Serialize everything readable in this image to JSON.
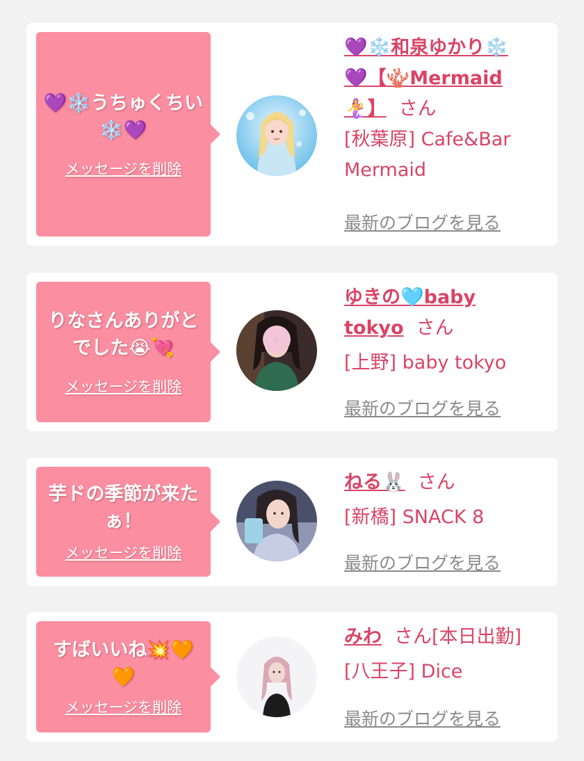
{
  "items": [
    {
      "message_prefix": "💜❄️",
      "message": "うちゅくちい",
      "message_suffix": "❄️💜",
      "delete_label": "メッセージを削除",
      "name_line1": "💜❄️和泉ゆかり❄️",
      "name_line2_a": "💜【",
      "name_line2_icon": "🪸",
      "name_line2_b": "Mermaid",
      "name_line3": "🧜‍♀️】",
      "honorific": "さん",
      "area": "[秋葉原] Cafe&Bar",
      "shop_line2": "Mermaid",
      "blog_label": "最新のブログを見る"
    },
    {
      "message_line1": "りなさんありがと",
      "message_line2": "でした",
      "message_emoji1": "😭",
      "message_emoji2": "💘",
      "delete_label": "メッセージを削除",
      "name_a": "ゆきの",
      "name_icon": "🩵",
      "name_b": "baby",
      "name_line2": "tokyo",
      "honorific": "さん",
      "area": "[上野] baby tokyo",
      "blog_label": "最新のブログを見る"
    },
    {
      "message_line1": "芋ドの季節が来た",
      "message_line2": "ぁ！",
      "delete_label": "メッセージを削除",
      "name": "ねる",
      "name_icon": "🐰",
      "honorific": "さん",
      "area": "[新橋] SNACK 8",
      "blog_label": "最新のブログを見る"
    },
    {
      "message_line1": "すばいいね",
      "message_emoji1": "💥",
      "message_emoji2": "🧡",
      "message_line2_emoji": "🧡",
      "delete_label": "メッセージを削除",
      "name": "みわ",
      "honorific": "さん[本日出勤]",
      "area": "[八王子] Dice",
      "blog_label": "最新のブログを見る"
    }
  ]
}
